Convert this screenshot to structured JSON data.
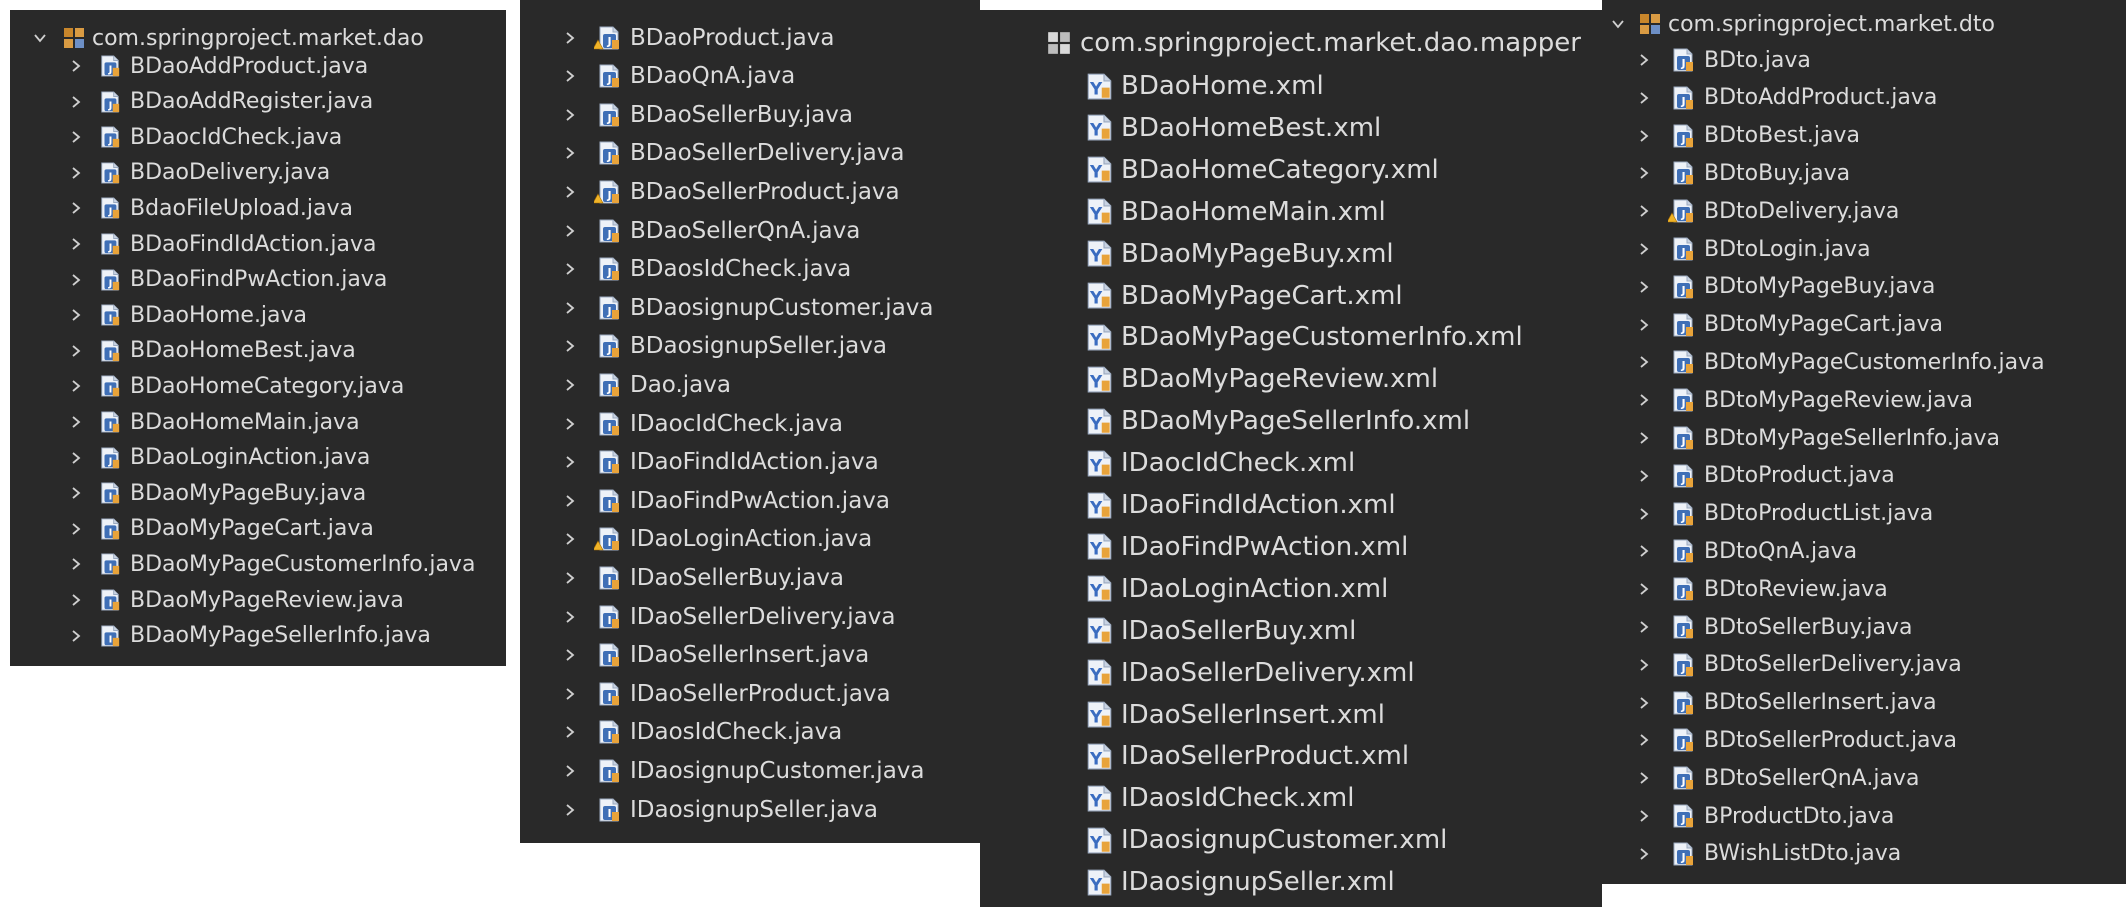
{
  "colors": {
    "background": "#292929",
    "text": "#dcdcdc",
    "java_file_icon": "#3f6fb6",
    "mapper_file_icon": "#3a6cc0",
    "package_icon": "#c8862b"
  },
  "panel_dao_left": {
    "package_label": "com.springproject.market.dao",
    "items": [
      {
        "label": "BDaoAddProduct.java",
        "icon": "java-class-icon"
      },
      {
        "label": "BDaoAddRegister.java",
        "icon": "java-class-icon"
      },
      {
        "label": "BDaocIdCheck.java",
        "icon": "java-class-icon"
      },
      {
        "label": "BDaoDelivery.java",
        "icon": "java-class-icon"
      },
      {
        "label": "BdaoFileUpload.java",
        "icon": "java-class-icon"
      },
      {
        "label": "BDaoFindIdAction.java",
        "icon": "java-class-icon"
      },
      {
        "label": "BDaoFindPwAction.java",
        "icon": "java-class-icon"
      },
      {
        "label": "BDaoHome.java",
        "icon": "java-interface-icon"
      },
      {
        "label": "BDaoHomeBest.java",
        "icon": "java-interface-icon"
      },
      {
        "label": "BDaoHomeCategory.java",
        "icon": "java-interface-icon"
      },
      {
        "label": "BDaoHomeMain.java",
        "icon": "java-interface-icon"
      },
      {
        "label": "BDaoLoginAction.java",
        "icon": "java-class-icon"
      },
      {
        "label": "BDaoMyPageBuy.java",
        "icon": "java-interface-icon"
      },
      {
        "label": "BDaoMyPageCart.java",
        "icon": "java-interface-icon"
      },
      {
        "label": "BDaoMyPageCustomerInfo.java",
        "icon": "java-interface-icon"
      },
      {
        "label": "BDaoMyPageReview.java",
        "icon": "java-interface-icon"
      },
      {
        "label": "BDaoMyPageSellerInfo.java",
        "icon": "java-interface-icon"
      }
    ]
  },
  "panel_dao_right": {
    "items": [
      {
        "label": "BDaoProduct.java",
        "icon": "java-class-warning-icon"
      },
      {
        "label": "BDaoQnA.java",
        "icon": "java-class-icon"
      },
      {
        "label": "BDaoSellerBuy.java",
        "icon": "java-class-icon"
      },
      {
        "label": "BDaoSellerDelivery.java",
        "icon": "java-class-icon"
      },
      {
        "label": "BDaoSellerProduct.java",
        "icon": "java-class-warning-icon"
      },
      {
        "label": "BDaoSellerQnA.java",
        "icon": "java-class-icon"
      },
      {
        "label": "BDaosIdCheck.java",
        "icon": "java-class-icon"
      },
      {
        "label": "BDaosignupCustomer.java",
        "icon": "java-class-icon"
      },
      {
        "label": "BDaosignupSeller.java",
        "icon": "java-class-icon"
      },
      {
        "label": "Dao.java",
        "icon": "java-class-icon"
      },
      {
        "label": "IDaocIdCheck.java",
        "icon": "java-interface-icon"
      },
      {
        "label": "IDaoFindIdAction.java",
        "icon": "java-interface-icon"
      },
      {
        "label": "IDaoFindPwAction.java",
        "icon": "java-interface-icon"
      },
      {
        "label": "IDaoLoginAction.java",
        "icon": "java-interface-warning-icon"
      },
      {
        "label": "IDaoSellerBuy.java",
        "icon": "java-interface-icon"
      },
      {
        "label": "IDaoSellerDelivery.java",
        "icon": "java-interface-icon"
      },
      {
        "label": "IDaoSellerInsert.java",
        "icon": "java-interface-icon"
      },
      {
        "label": "IDaoSellerProduct.java",
        "icon": "java-interface-icon"
      },
      {
        "label": "IDaosIdCheck.java",
        "icon": "java-interface-icon"
      },
      {
        "label": "IDaosignupCustomer.java",
        "icon": "java-interface-icon"
      },
      {
        "label": "IDaosignupSeller.java",
        "icon": "java-interface-icon"
      }
    ]
  },
  "panel_mapper": {
    "package_label": "com.springproject.market.dao.mapper",
    "items": [
      {
        "label": "BDaoHome.xml"
      },
      {
        "label": "BDaoHomeBest.xml"
      },
      {
        "label": "BDaoHomeCategory.xml"
      },
      {
        "label": "BDaoHomeMain.xml"
      },
      {
        "label": "BDaoMyPageBuy.xml"
      },
      {
        "label": "BDaoMyPageCart.xml"
      },
      {
        "label": "BDaoMyPageCustomerInfo.xml"
      },
      {
        "label": "BDaoMyPageReview.xml"
      },
      {
        "label": "BDaoMyPageSellerInfo.xml"
      },
      {
        "label": "IDaocIdCheck.xml"
      },
      {
        "label": "IDaoFindIdAction.xml"
      },
      {
        "label": "IDaoFindPwAction.xml"
      },
      {
        "label": "IDaoLoginAction.xml"
      },
      {
        "label": "IDaoSellerBuy.xml"
      },
      {
        "label": "IDaoSellerDelivery.xml"
      },
      {
        "label": "IDaoSellerInsert.xml"
      },
      {
        "label": "IDaoSellerProduct.xml"
      },
      {
        "label": "IDaosIdCheck.xml"
      },
      {
        "label": "IDaosignupCustomer.xml"
      },
      {
        "label": "IDaosignupSeller.xml"
      }
    ]
  },
  "panel_dto": {
    "package_label": "com.springproject.market.dto",
    "items": [
      {
        "label": "BDto.java",
        "icon": "java-class-icon"
      },
      {
        "label": "BDtoAddProduct.java",
        "icon": "java-class-icon"
      },
      {
        "label": "BDtoBest.java",
        "icon": "java-class-icon"
      },
      {
        "label": "BDtoBuy.java",
        "icon": "java-class-icon"
      },
      {
        "label": "BDtoDelivery.java",
        "icon": "java-class-warning-icon"
      },
      {
        "label": "BDtoLogin.java",
        "icon": "java-class-icon"
      },
      {
        "label": "BDtoMyPageBuy.java",
        "icon": "java-class-icon"
      },
      {
        "label": "BDtoMyPageCart.java",
        "icon": "java-class-icon"
      },
      {
        "label": "BDtoMyPageCustomerInfo.java",
        "icon": "java-class-icon"
      },
      {
        "label": "BDtoMyPageReview.java",
        "icon": "java-class-icon"
      },
      {
        "label": "BDtoMyPageSellerInfo.java",
        "icon": "java-class-icon"
      },
      {
        "label": "BDtoProduct.java",
        "icon": "java-class-icon"
      },
      {
        "label": "BDtoProductList.java",
        "icon": "java-class-icon"
      },
      {
        "label": "BDtoQnA.java",
        "icon": "java-class-icon"
      },
      {
        "label": "BDtoReview.java",
        "icon": "java-class-icon"
      },
      {
        "label": "BDtoSellerBuy.java",
        "icon": "java-class-icon"
      },
      {
        "label": "BDtoSellerDelivery.java",
        "icon": "java-class-icon"
      },
      {
        "label": "BDtoSellerInsert.java",
        "icon": "java-class-icon"
      },
      {
        "label": "BDtoSellerProduct.java",
        "icon": "java-class-icon"
      },
      {
        "label": "BDtoSellerQnA.java",
        "icon": "java-class-icon"
      },
      {
        "label": "BProductDto.java",
        "icon": "java-class-icon"
      },
      {
        "label": "BWishListDto.java",
        "icon": "java-class-icon"
      }
    ]
  }
}
